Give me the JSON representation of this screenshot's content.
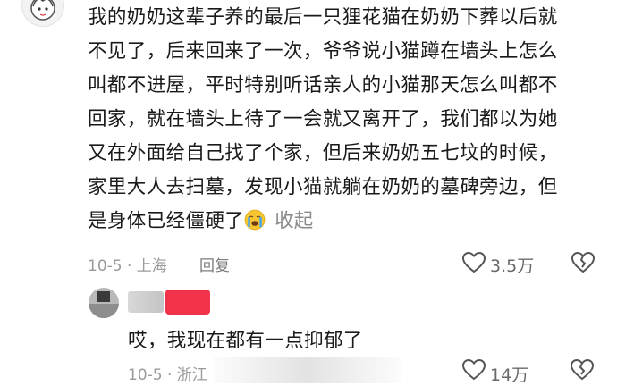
{
  "comment": {
    "lines": [
      "我的奶奶这辈子养的最后一只狸花猫在奶奶下葬以后就",
      "不见了，后来回来了一次，爷爷说小猫蹲在墙头上怎么",
      "叫都不进屋，平时特别听话亲人的小猫那天怎么叫都不",
      "回家，就在墙头上待了一会就又离开了，我们都以为她",
      "又在外面给自己找了个家，但后来奶奶五七坟的时候，",
      "家里大人去扫墓，发现小猫就躺在奶奶的墓碑旁边，但",
      "是身体已经僵硬了"
    ],
    "emoji_icon": "crying-face-icon",
    "collapse_label": "收起",
    "time_location": "10-5 · 上海",
    "reply_label": "回复",
    "like_icon": "heart-outline-icon",
    "like_count": "3.5万",
    "dislike_icon": "broken-heart-icon"
  },
  "reply": {
    "text": "哎，我现在都有一点抑郁了",
    "time_location": "10-5 · 浙江",
    "like_icon": "heart-outline-icon",
    "like_count": "14万",
    "dislike_icon": "broken-heart-icon"
  },
  "colors": {
    "text": "#1a1a1a",
    "meta": "#9a9a9a",
    "badge": "#f0334a"
  }
}
